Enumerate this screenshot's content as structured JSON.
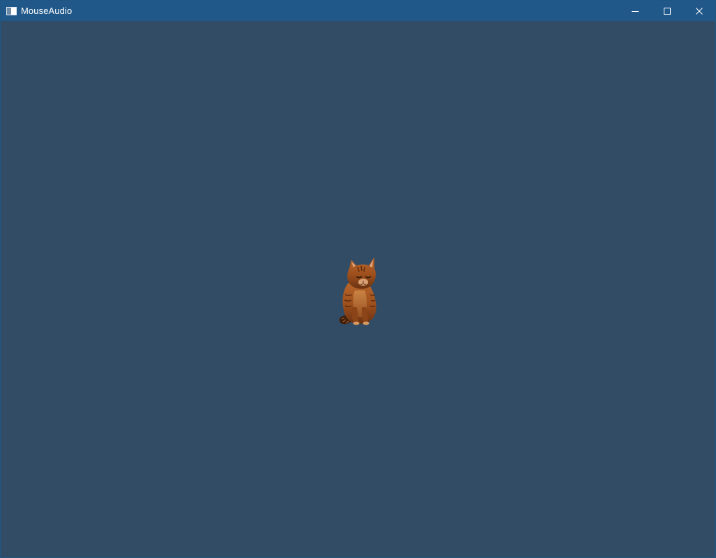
{
  "window": {
    "title": "MouseAudio",
    "background_color": "#324c66",
    "titlebar_color": "#21588a",
    "icons": {
      "app": "app-window-icon",
      "minimize": "minimize-icon",
      "maximize": "maximize-icon",
      "close": "close-icon"
    }
  },
  "scene": {
    "sprite": "cat-image"
  }
}
